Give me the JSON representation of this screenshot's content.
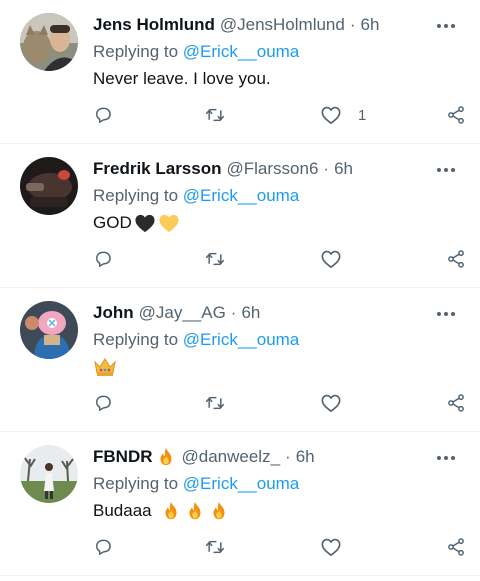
{
  "tweets": [
    {
      "name": "Jens Holmlund",
      "handle": "@JensHolmlund",
      "separator": "·",
      "time": "6h",
      "replying_prefix": "Replying to",
      "replying_to": "@Erick__ouma",
      "text": "Never leave. I love you.",
      "like_count": "1",
      "avatar": "avatar-man-with-cat",
      "emojis": []
    },
    {
      "name": "Fredrik Larsson",
      "handle": "@Flarsson6",
      "separator": "·",
      "time": "6h",
      "replying_prefix": "Replying to",
      "replying_to": "@Erick__ouma",
      "text": "GOD",
      "like_count": "",
      "avatar": "avatar-dark-photo",
      "emojis": [
        "black-heart-icon",
        "yellow-heart-icon"
      ]
    },
    {
      "name": "John",
      "handle": "@Jay__AG",
      "separator": "·",
      "time": "6h",
      "replying_prefix": "Replying to",
      "replying_to": "@Erick__ouma",
      "text": "",
      "like_count": "",
      "avatar": "avatar-cartoon-character",
      "emojis": [
        "crown-icon"
      ]
    },
    {
      "name": "FBNDR",
      "handle": "@danweelz_",
      "separator": "·",
      "time": "6h",
      "replying_prefix": "Replying to",
      "replying_to": "@Erick__ouma",
      "text": "Budaaa",
      "like_count": "",
      "avatar": "avatar-person-outdoors",
      "emojis": [
        "fire-icon",
        "fire-icon",
        "fire-icon"
      ],
      "name_emoji": "fire-icon"
    }
  ],
  "colors": {
    "text": "#0f1419",
    "secondary": "#536471",
    "accent": "#1d9bf0",
    "divider": "#eff3f4"
  }
}
